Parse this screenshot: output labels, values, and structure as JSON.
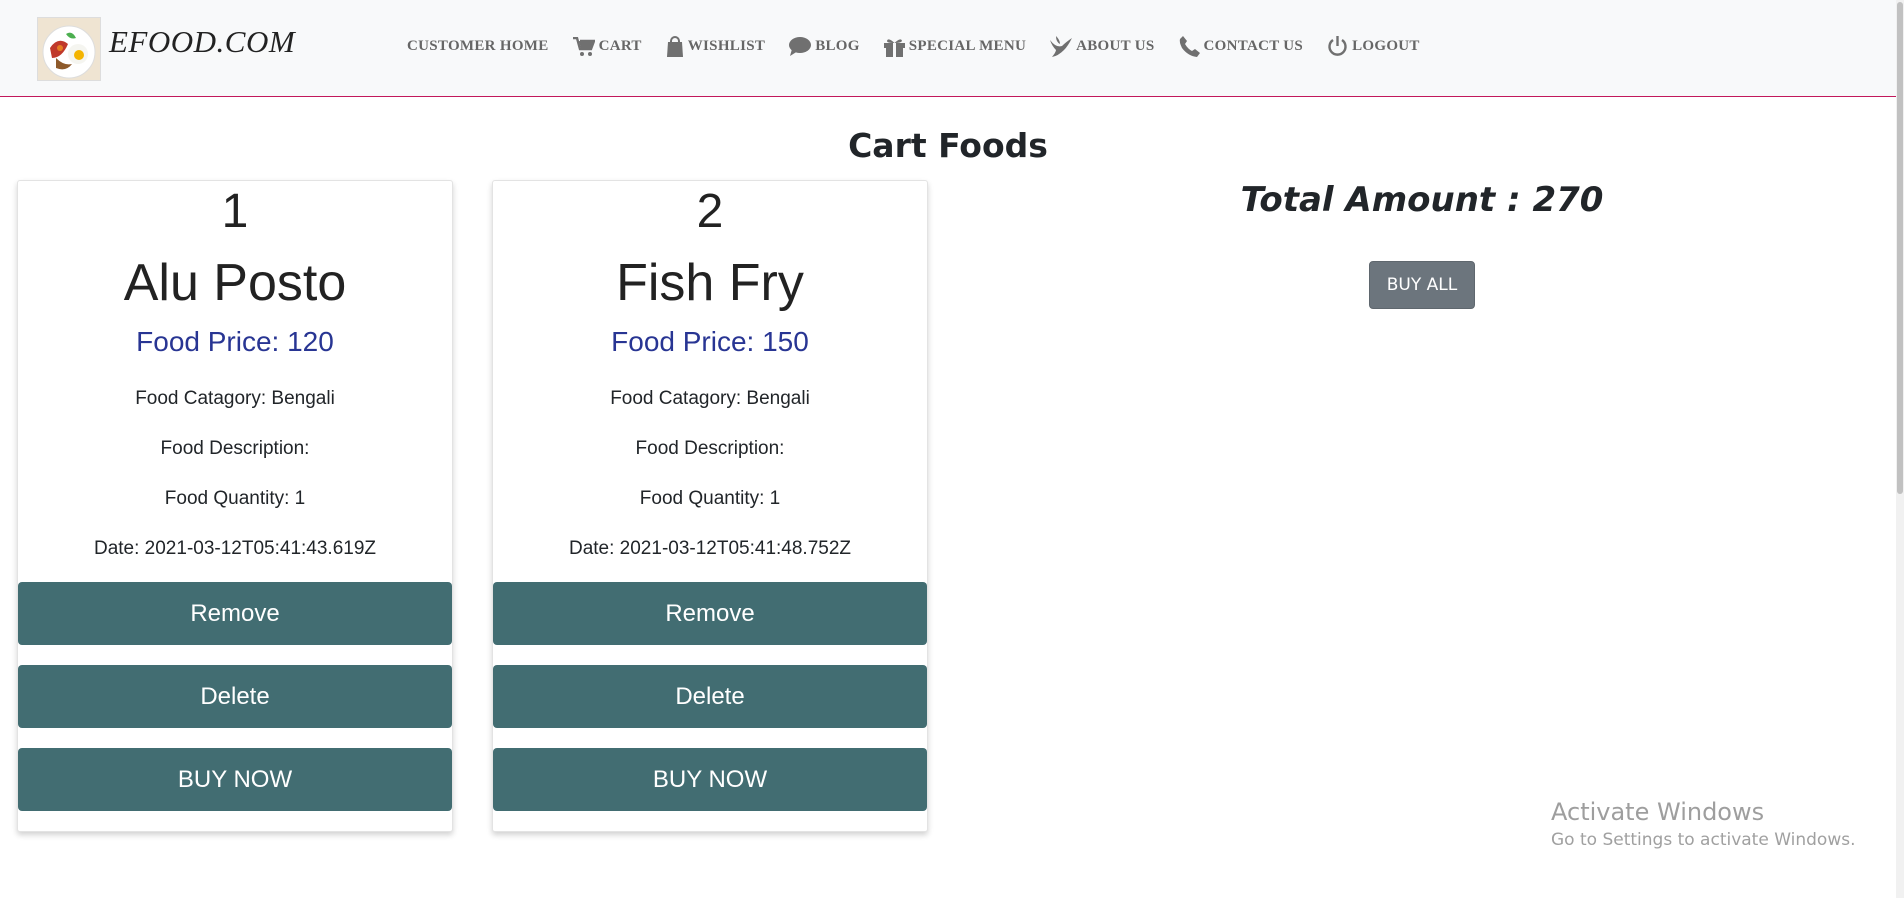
{
  "brand": {
    "name": "EFOOD.COM"
  },
  "nav": {
    "items": [
      {
        "label": "CUSTOMER HOME",
        "icon": ""
      },
      {
        "label": "CART",
        "icon": "cart-icon"
      },
      {
        "label": "WISHLIST",
        "icon": "shopping-bag-icon"
      },
      {
        "label": "BLOG",
        "icon": "comment-icon"
      },
      {
        "label": "SPECIAL MENU",
        "icon": "gift-icon"
      },
      {
        "label": "ABOUT US",
        "icon": "dove-icon"
      },
      {
        "label": "CONTACT US",
        "icon": "phone-icon"
      },
      {
        "label": "LOGOUT",
        "icon": "power-icon"
      }
    ]
  },
  "page": {
    "title": "Cart Foods"
  },
  "cart": {
    "items": [
      {
        "index": "1",
        "name": "Alu Posto",
        "price": "Food Price: 120",
        "category": "Food Catagory: Bengali",
        "description": "Food Description:",
        "quantity": "Food Quantity: 1",
        "date": "Date: 2021-03-12T05:41:43.619Z",
        "remove_label": "Remove",
        "delete_label": "Delete",
        "buy_label": "BUY NOW"
      },
      {
        "index": "2",
        "name": "Fish Fry",
        "price": "Food Price: 150",
        "category": "Food Catagory: Bengali",
        "description": "Food Description:",
        "quantity": "Food Quantity: 1",
        "date": "Date: 2021-03-12T05:41:48.752Z",
        "remove_label": "Remove",
        "delete_label": "Delete",
        "buy_label": "BUY NOW"
      }
    ]
  },
  "summary": {
    "total": "Total Amount : 270",
    "buy_all_label": "BUY ALL"
  },
  "watermark": {
    "title": "Activate Windows",
    "subtitle": "Go to Settings to activate Windows."
  },
  "colors": {
    "button": "#426d72",
    "price_text": "#283593",
    "navbar_border": "#c2185b",
    "buy_all": "#6c757d"
  }
}
